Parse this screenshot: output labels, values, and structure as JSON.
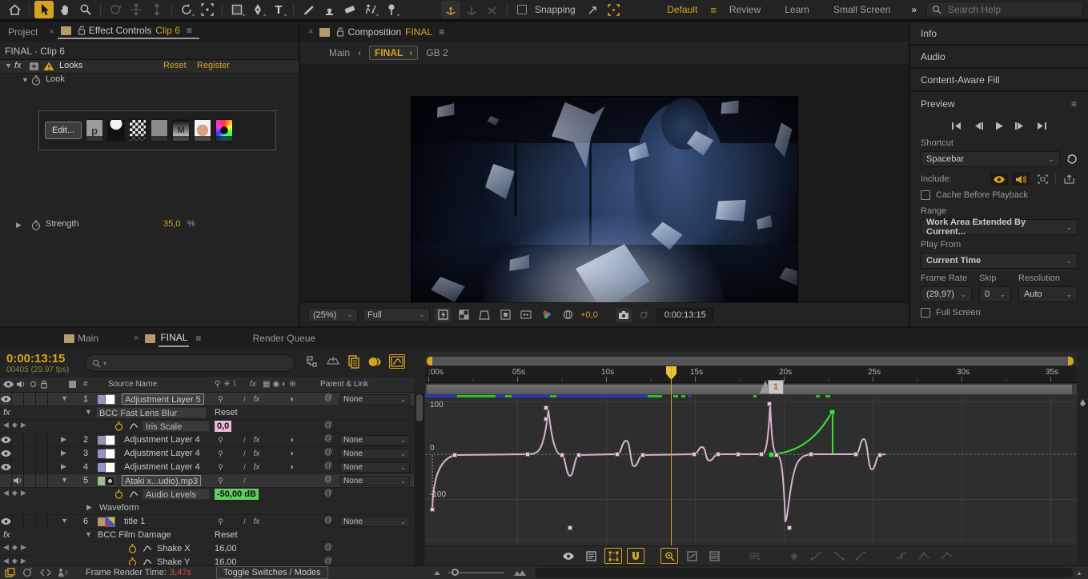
{
  "colors": {
    "accent": "#d6a41f",
    "selection_pink": "#eab7da",
    "audio_green": "#5ed05e",
    "warning_red": "#e0483e",
    "label_purple": "#9593c4",
    "label_green": "#9cbf8e",
    "label_sand": "#b59a6b"
  },
  "toolbar": {
    "workspaces": [
      "Default",
      "Review",
      "Learn",
      "Small Screen"
    ],
    "active_workspace": "Default",
    "snapping_label": "Snapping",
    "search_placeholder": "Search Help",
    "overflow_glyph": "»"
  },
  "effect_controls": {
    "project_tab": "Project",
    "tab_title": "Effect Controls",
    "tab_target": "Clip 6",
    "comp_line": "FINAL · Clip 6",
    "effect_name": "Looks",
    "reset": "Reset",
    "register": "Register",
    "look_label": "Look",
    "edit_button": "Edit...",
    "strength_label": "Strength",
    "strength_value": "35,0",
    "strength_unit": "%"
  },
  "composition": {
    "tab_title": "Composition",
    "tab_target": "FINAL",
    "crumb_main": "Main",
    "crumb_final": "FINAL",
    "crumb_gb2": "GB 2",
    "crumb_sep": "‹",
    "zoom_value": "(25%)",
    "resolution_value": "Full",
    "exposure_value": "+0,0",
    "timecode": "0:00:13:15"
  },
  "right_panel": {
    "info": "Info",
    "audio": "Audio",
    "caf": "Content-Aware Fill",
    "preview": {
      "title": "Preview",
      "shortcut_label": "Shortcut",
      "shortcut_value": "Spacebar",
      "include_label": "Include:",
      "cache_label": "Cache Before Playback",
      "range_label": "Range",
      "range_value": "Work Area Extended By Current...",
      "play_from_label": "Play From",
      "play_from_value": "Current Time",
      "frame_rate_label": "Frame Rate",
      "frame_rate_value": "(29,97)",
      "skip_label": "Skip",
      "skip_value": "0",
      "resolution_label": "Resolution",
      "resolution_value": "Auto",
      "fullscreen_label": "Full Screen"
    }
  },
  "timeline": {
    "tab_main": "Main",
    "tab_final": "FINAL",
    "tab_render_queue": "Render Queue",
    "timecode": "0:00:13:15",
    "frame_info": "00405 (29.97 fps)",
    "col_source_name": "Source Name",
    "col_parent": "Parent & Link",
    "rows": {
      "r1": {
        "num": "1",
        "name": "Adjustment Layer 5",
        "parent": "None"
      },
      "r2": {
        "name": "BCC Fast Lens Blur",
        "reset": "Reset"
      },
      "r3": {
        "name": "Iris Scale",
        "value": "0,0"
      },
      "r4": {
        "num": "2",
        "name": "Adjustment Layer 4",
        "parent": "None"
      },
      "r5": {
        "num": "3",
        "name": "Adjustment Layer 4",
        "parent": "None"
      },
      "r6": {
        "num": "4",
        "name": "Adjustment Layer 4",
        "parent": "None"
      },
      "r7": {
        "num": "5",
        "name": "Ataki x...udio).mp3",
        "parent": "None"
      },
      "r8": {
        "name": "Audio Levels",
        "value": "-50,00 dB"
      },
      "r9": {
        "name": "Waveform"
      },
      "r10": {
        "num": "6",
        "name": "title 1",
        "parent": "None"
      },
      "r11": {
        "name": "BCC Film Damage",
        "reset": "Reset"
      },
      "r12": {
        "name": "Shake X",
        "value": "16,00"
      },
      "r13": {
        "name": "Shake Y",
        "value": "16,00"
      }
    },
    "ruler": [
      ":00s",
      "05s",
      "10s",
      "15s",
      "20s",
      "25s",
      "30s",
      "35s"
    ],
    "marker_label": "1",
    "graph_labels": {
      "top": "100",
      "mid": "0",
      "bottom": "-100"
    },
    "footer": {
      "render_label": "Frame Render Time:",
      "render_value": "3,47s",
      "toggle_button": "Toggle Switches / Modes"
    }
  }
}
